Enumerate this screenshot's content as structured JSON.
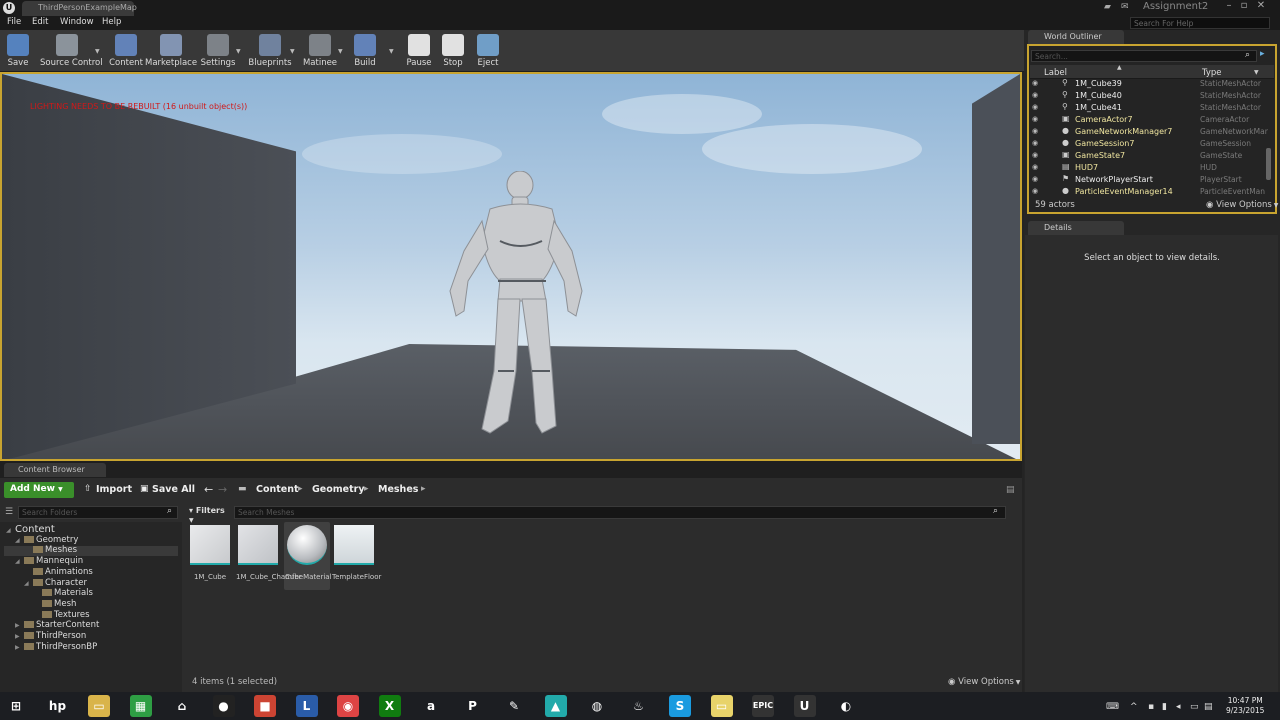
{
  "app": {
    "doc_tab": "ThirdPersonExampleMap",
    "project_name": "Assignment2",
    "help_search_placeholder": "Search For Help"
  },
  "menu": [
    "File",
    "Edit",
    "Window",
    "Help"
  ],
  "toolbar": [
    {
      "label": "Save",
      "icon": "save-icon",
      "color": "#5b8fd6"
    },
    {
      "label": "Source Control",
      "icon": "source-control-icon",
      "color": "#9aa3ad"
    },
    {
      "label": "Content",
      "icon": "content-icon",
      "color": "#6a8fcf"
    },
    {
      "label": "Marketplace",
      "icon": "marketplace-icon",
      "color": "#8fa4c8"
    },
    {
      "label": "Settings",
      "icon": "settings-icon",
      "color": "#8a8f96"
    },
    {
      "label": "Blueprints",
      "icon": "blueprints-icon",
      "color": "#7a8fb0"
    },
    {
      "label": "Matinee",
      "icon": "matinee-icon",
      "color": "#8a8f96"
    },
    {
      "label": "Build",
      "icon": "build-icon",
      "color": "#6a8fcf"
    },
    {
      "label": "Pause",
      "icon": "pause-icon",
      "color": "#ffffff"
    },
    {
      "label": "Stop",
      "icon": "stop-icon",
      "color": "#ffffff"
    },
    {
      "label": "Eject",
      "icon": "eject-icon",
      "color": "#7ab0e0"
    }
  ],
  "viewport": {
    "warning": "LIGHTING NEEDS TO BE REBUILT (16 unbuilt object(s))"
  },
  "content_browser": {
    "tab": "Content Browser",
    "add_new": "Add New",
    "import": "Import",
    "save_all": "Save All",
    "breadcrumb": [
      "Content",
      "Geometry",
      "Meshes"
    ],
    "folder_search_placeholder": "Search Folders",
    "filters": "Filters",
    "asset_search_placeholder": "Search Meshes",
    "tree": [
      {
        "label": "Content",
        "level": 0
      },
      {
        "label": "Geometry",
        "level": 1
      },
      {
        "label": "Meshes",
        "level": 2
      },
      {
        "label": "Mannequin",
        "level": 1
      },
      {
        "label": "Animations",
        "level": 2
      },
      {
        "label": "Character",
        "level": 2
      },
      {
        "label": "Materials",
        "level": 3
      },
      {
        "label": "Mesh",
        "level": 3
      },
      {
        "label": "Textures",
        "level": 3
      },
      {
        "label": "StarterContent",
        "level": 1
      },
      {
        "label": "ThirdPerson",
        "level": 1
      },
      {
        "label": "ThirdPersonBP",
        "level": 1
      }
    ],
    "assets": [
      {
        "label": "1M_Cube"
      },
      {
        "label": "1M_Cube_Chamfer"
      },
      {
        "label": "CubeMaterial"
      },
      {
        "label": "TemplateFloor"
      }
    ],
    "items_count": "4 items (1 selected)",
    "view_options": "View Options"
  },
  "world_outliner": {
    "tab": "World Outliner",
    "search_placeholder": "Search...",
    "col_label": "Label",
    "col_type": "Type",
    "rows": [
      {
        "name": "1M_Cube39",
        "type": "StaticMeshActor",
        "highlight": false
      },
      {
        "name": "1M_Cube40",
        "type": "StaticMeshActor",
        "highlight": false
      },
      {
        "name": "1M_Cube41",
        "type": "StaticMeshActor",
        "highlight": false
      },
      {
        "name": "CameraActor7",
        "type": "CameraActor",
        "highlight": true
      },
      {
        "name": "GameNetworkManager7",
        "type": "GameNetworkMan",
        "highlight": true
      },
      {
        "name": "GameSession7",
        "type": "GameSession",
        "highlight": true
      },
      {
        "name": "GameState7",
        "type": "GameState",
        "highlight": true
      },
      {
        "name": "HUD7",
        "type": "HUD",
        "highlight": true
      },
      {
        "name": "NetworkPlayerStart",
        "type": "PlayerStart",
        "highlight": false
      },
      {
        "name": "ParticleEventManager14",
        "type": "ParticleEventMan",
        "highlight": true
      }
    ],
    "actor_count": "59 actors",
    "view_options": "View Options"
  },
  "details": {
    "tab": "Details",
    "empty_message": "Select an object to view details."
  },
  "taskbar": {
    "apps": [
      {
        "icon": "windows-start-icon",
        "glyph": "⊞",
        "color": "#1c1e22"
      },
      {
        "icon": "hp-icon",
        "glyph": "hp",
        "color": "#1c1e22"
      },
      {
        "icon": "file-explorer-icon",
        "glyph": "▭",
        "color": "#d9b44a"
      },
      {
        "icon": "calculator-icon",
        "glyph": "▦",
        "color": "#2e9e44"
      },
      {
        "icon": "home-icon",
        "glyph": "⌂",
        "color": "#1c1e22"
      },
      {
        "icon": "media-player-icon",
        "glyph": "●",
        "color": "#222"
      },
      {
        "icon": "rubiks-icon",
        "glyph": "■",
        "color": "#c43"
      },
      {
        "icon": "lightroom-icon",
        "glyph": "L",
        "color": "#2a5ca8"
      },
      {
        "icon": "chrome-icon",
        "glyph": "◉",
        "color": "#d44"
      },
      {
        "icon": "xbox-icon",
        "glyph": "X",
        "color": "#107c10"
      },
      {
        "icon": "amazon-icon",
        "glyph": "a",
        "color": "#1c1e22"
      },
      {
        "icon": "p-app-icon",
        "glyph": "P",
        "color": "#1c1e22"
      },
      {
        "icon": "pen-icon",
        "glyph": "✎",
        "color": "#1c1e22"
      },
      {
        "icon": "maps-icon",
        "glyph": "▲",
        "color": "#2aa"
      },
      {
        "icon": "steam-icon",
        "glyph": "◍",
        "color": "#1c1e22"
      },
      {
        "icon": "flame-icon",
        "glyph": "♨",
        "color": "#1c1e22"
      },
      {
        "icon": "skype-icon",
        "glyph": "S",
        "color": "#1a9be0"
      },
      {
        "icon": "folder-icon",
        "glyph": "▭",
        "color": "#e8d36a"
      },
      {
        "icon": "epic-launcher-icon",
        "glyph": "EPIC",
        "color": "#333"
      },
      {
        "icon": "unreal-editor-icon",
        "glyph": "U",
        "color": "#333"
      },
      {
        "icon": "obs-icon",
        "glyph": "◐",
        "color": "#1c1e22"
      }
    ],
    "time": "10:47 PM",
    "date": "9/23/2015"
  }
}
